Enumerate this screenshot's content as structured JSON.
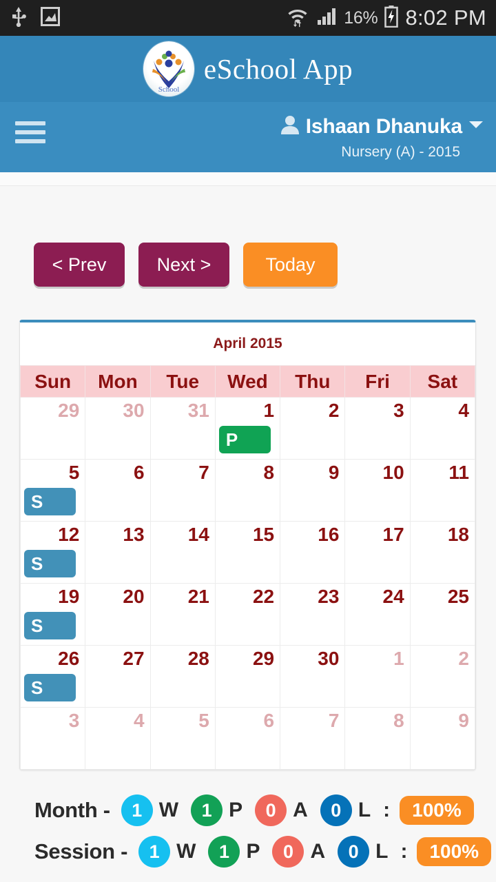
{
  "status_bar": {
    "icons_left": [
      "usb-icon",
      "screenshot-image-icon"
    ],
    "icons_right": [
      "wifi-icon",
      "signal-icon",
      "battery-charging-icon"
    ],
    "battery_percent": "16%",
    "clock": "8:02 PM"
  },
  "app_bar": {
    "logo": "eschool-logo-icon",
    "title": "eSchool App",
    "bg_color": "#3486b9"
  },
  "user_bar": {
    "menu_icon": "hamburger-menu-icon",
    "user_icon": "user-avatar-icon",
    "user_name": "Ishaan Dhanuka",
    "dropdown_icon": "chevron-down-icon",
    "class_info": "Nursery (A) - 2015"
  },
  "toolbar": {
    "prev_label": "< Prev",
    "next_label": "Next >",
    "today_label": "Today",
    "prev_color": "#8c1d52",
    "next_color": "#8c1d52",
    "today_color": "#fa8e24"
  },
  "calendar": {
    "title": "April 2015",
    "weekdays": [
      "Sun",
      "Mon",
      "Tue",
      "Wed",
      "Thu",
      "Fri",
      "Sat"
    ],
    "weeks": [
      [
        {
          "day": "29",
          "other": true,
          "event": ""
        },
        {
          "day": "30",
          "other": true,
          "event": ""
        },
        {
          "day": "31",
          "other": true,
          "event": ""
        },
        {
          "day": "1",
          "other": false,
          "event": "P"
        },
        {
          "day": "2",
          "other": false,
          "event": ""
        },
        {
          "day": "3",
          "other": false,
          "event": ""
        },
        {
          "day": "4",
          "other": false,
          "event": ""
        }
      ],
      [
        {
          "day": "5",
          "other": false,
          "event": "S"
        },
        {
          "day": "6",
          "other": false,
          "event": ""
        },
        {
          "day": "7",
          "other": false,
          "event": ""
        },
        {
          "day": "8",
          "other": false,
          "event": ""
        },
        {
          "day": "9",
          "other": false,
          "event": ""
        },
        {
          "day": "10",
          "other": false,
          "event": ""
        },
        {
          "day": "11",
          "other": false,
          "event": ""
        }
      ],
      [
        {
          "day": "12",
          "other": false,
          "event": "S"
        },
        {
          "day": "13",
          "other": false,
          "event": ""
        },
        {
          "day": "14",
          "other": false,
          "event": ""
        },
        {
          "day": "15",
          "other": false,
          "event": ""
        },
        {
          "day": "16",
          "other": false,
          "event": ""
        },
        {
          "day": "17",
          "other": false,
          "event": ""
        },
        {
          "day": "18",
          "other": false,
          "event": ""
        }
      ],
      [
        {
          "day": "19",
          "other": false,
          "event": "S"
        },
        {
          "day": "20",
          "other": false,
          "event": ""
        },
        {
          "day": "21",
          "other": false,
          "event": ""
        },
        {
          "day": "22",
          "other": false,
          "event": ""
        },
        {
          "day": "23",
          "other": false,
          "event": ""
        },
        {
          "day": "24",
          "other": false,
          "event": ""
        },
        {
          "day": "25",
          "other": false,
          "event": ""
        }
      ],
      [
        {
          "day": "26",
          "other": false,
          "event": "S"
        },
        {
          "day": "27",
          "other": false,
          "event": ""
        },
        {
          "day": "28",
          "other": false,
          "event": ""
        },
        {
          "day": "29",
          "other": false,
          "event": ""
        },
        {
          "day": "30",
          "other": false,
          "event": ""
        },
        {
          "day": "1",
          "other": true,
          "event": ""
        },
        {
          "day": "2",
          "other": true,
          "event": ""
        }
      ],
      [
        {
          "day": "3",
          "other": true,
          "event": ""
        },
        {
          "day": "4",
          "other": true,
          "event": ""
        },
        {
          "day": "5",
          "other": true,
          "event": ""
        },
        {
          "day": "6",
          "other": true,
          "event": ""
        },
        {
          "day": "7",
          "other": true,
          "event": ""
        },
        {
          "day": "8",
          "other": true,
          "event": ""
        },
        {
          "day": "9",
          "other": true,
          "event": ""
        }
      ]
    ],
    "event_colors": {
      "P": "#10a354",
      "S": "#4291b8"
    }
  },
  "summary": {
    "rows": [
      {
        "label": "Month -",
        "stats": [
          {
            "count": "1",
            "code": "W",
            "color": "#16c0f0"
          },
          {
            "count": "1",
            "code": "P",
            "color": "#12a156"
          },
          {
            "count": "0",
            "code": "A",
            "color": "#f0685c"
          },
          {
            "count": "0",
            "code": "L",
            "color": "#0572b8"
          }
        ],
        "separator": ":",
        "percent": "100%"
      },
      {
        "label": "Session -",
        "stats": [
          {
            "count": "1",
            "code": "W",
            "color": "#16c0f0"
          },
          {
            "count": "1",
            "code": "P",
            "color": "#12a156"
          },
          {
            "count": "0",
            "code": "A",
            "color": "#f0685c"
          },
          {
            "count": "0",
            "code": "L",
            "color": "#0572b8"
          }
        ],
        "separator": ":",
        "percent": "100%"
      }
    ],
    "percent_color": "#fa8e24"
  }
}
